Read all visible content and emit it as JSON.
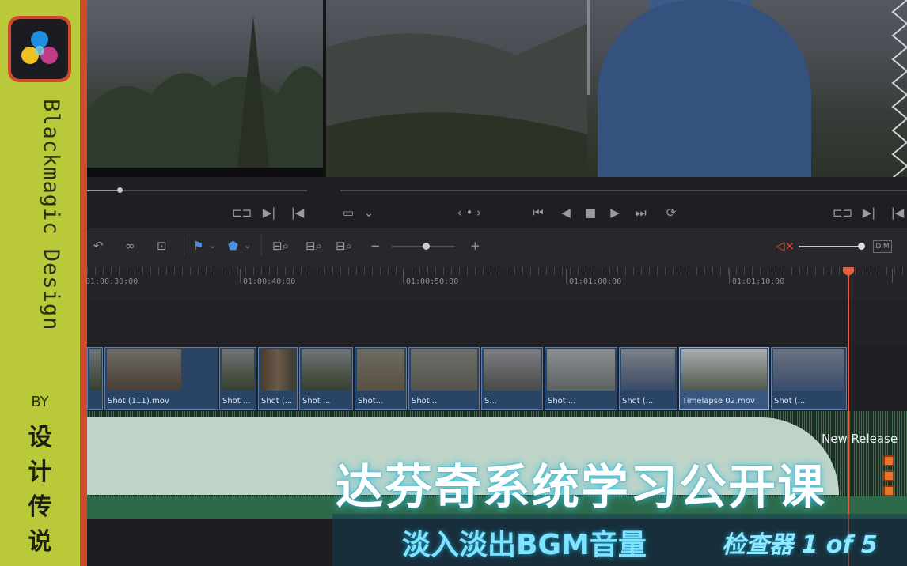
{
  "branding": {
    "vertical_title": "Blackmagic Design",
    "by": "BY",
    "author_chars": [
      "设",
      "计",
      "传",
      "说"
    ]
  },
  "toolbar": {
    "timecodes": [
      "01:00:30:00",
      "01:00:40:00",
      "01:00:50:00",
      "01:01:00:00",
      "01:01:10:00"
    ],
    "dim_label": "DIM"
  },
  "clips": [
    "",
    "Shot (111).mov",
    "",
    "Shot ...",
    "Shot (...",
    "Shot ...",
    "Shot...",
    "Shot...",
    "S...",
    "Shot ...",
    "Shot (...",
    "Timelapse 02.mov",
    "Shot (..."
  ],
  "overlay": {
    "tag": "New Release",
    "title": "达芬奇系统学习公开课",
    "subtitle": "淡入淡出BGM音量",
    "part": "检查器 1 of 5"
  },
  "colors": {
    "brand_green": "#b9c93a",
    "brand_red": "#d24a2c",
    "clip_blue": "#2a4466",
    "audio_green": "#2d6a4a",
    "playhead": "#e0603f",
    "glow_cyan": "#38c4e0"
  },
  "icons": [
    "davinci-resolve-logo-icon",
    "snap-magnet-icon",
    "link-icon",
    "lock-icon",
    "flag-icon",
    "marker-icon",
    "zoom-fit-icon",
    "mute-icon"
  ]
}
